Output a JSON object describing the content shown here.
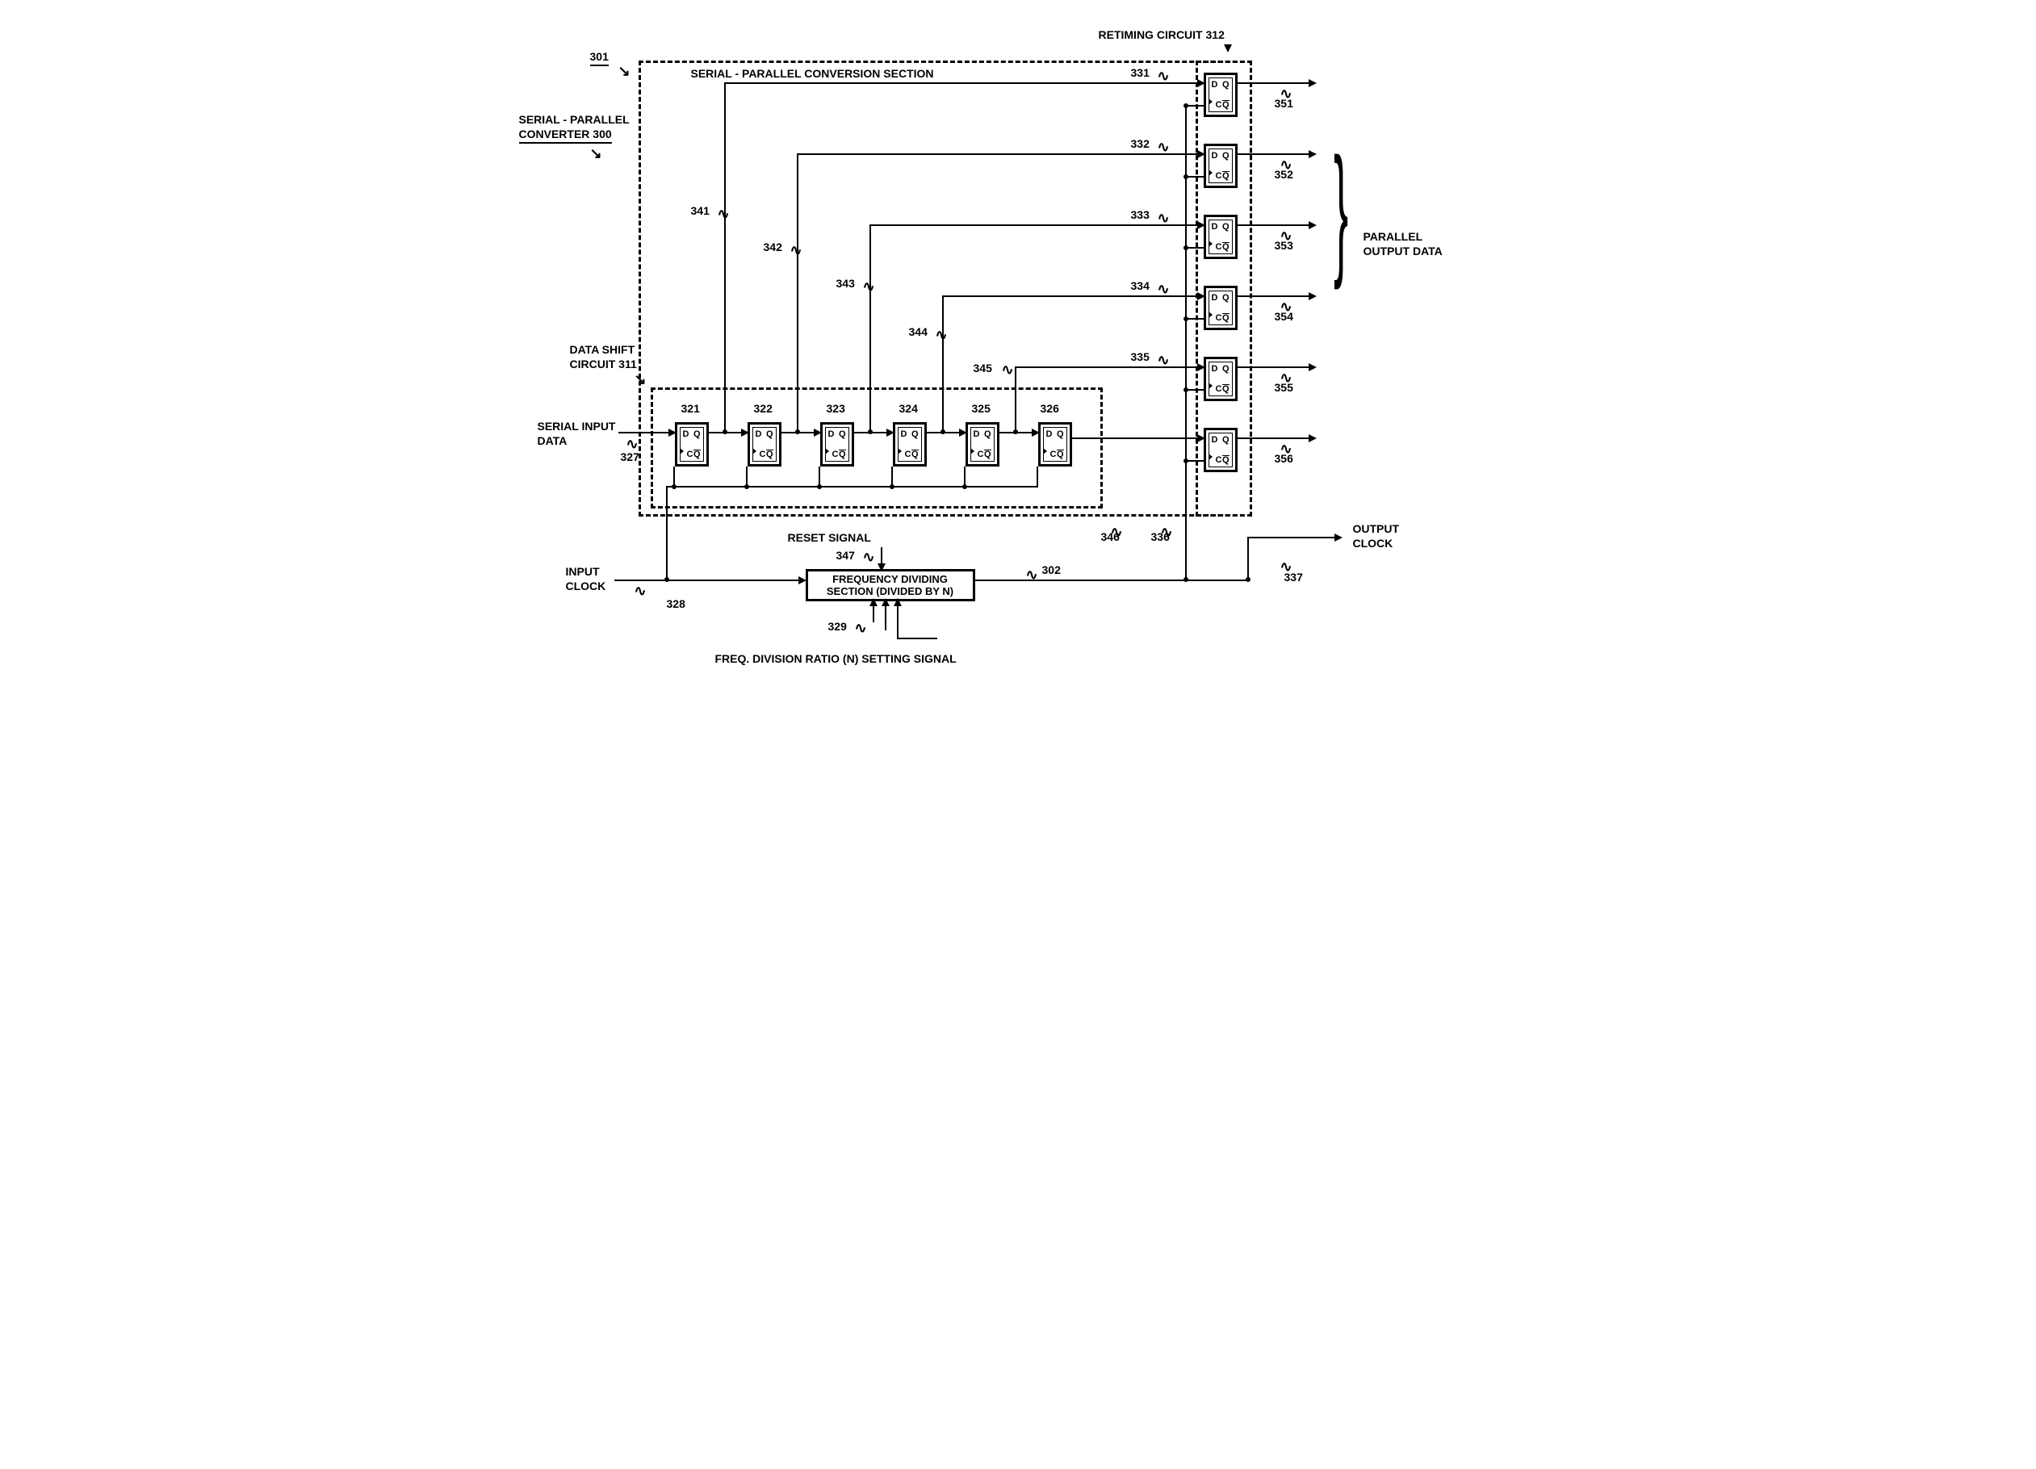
{
  "title_converter": "SERIAL - PARALLEL\nCONVERTER 300",
  "title_retiming": "RETIMING CIRCUIT 312",
  "title_conversion_section": "SERIAL - PARALLEL CONVERSION SECTION",
  "title_data_shift": "DATA SHIFT\nCIRCUIT 311",
  "label_301": "301",
  "label_parallel_output": "PARALLEL\nOUTPUT DATA",
  "label_serial_input": "SERIAL INPUT\nDATA",
  "label_input_clock": "INPUT\nCLOCK",
  "label_output_clock": "OUTPUT\nCLOCK",
  "label_reset": "RESET SIGNAL",
  "label_freq_box_l1": "FREQUENCY DIVIDING",
  "label_freq_box_l2": "SECTION (DIVIDED BY N)",
  "label_freq_ratio": "FREQ. DIVISION RATIO (N) SETTING SIGNAL",
  "ref_shift": {
    "321": "321",
    "322": "322",
    "323": "323",
    "324": "324",
    "325": "325",
    "326": "326"
  },
  "ref_wire": {
    "327": "327",
    "328": "328",
    "329": "329",
    "302": "302",
    "337": "337",
    "347": "347"
  },
  "ref_retime": {
    "331": "331",
    "332": "332",
    "333": "333",
    "334": "334",
    "335": "335",
    "336": "336"
  },
  "ref_out": {
    "351": "351",
    "352": "352",
    "353": "353",
    "354": "354",
    "355": "355",
    "356": "356"
  },
  "ref_inner": {
    "341": "341",
    "342": "342",
    "343": "343",
    "344": "344",
    "345": "345",
    "346": "346"
  },
  "ff": {
    "d": "D",
    "q": "Q",
    "c": "C",
    "qb": "Q"
  }
}
